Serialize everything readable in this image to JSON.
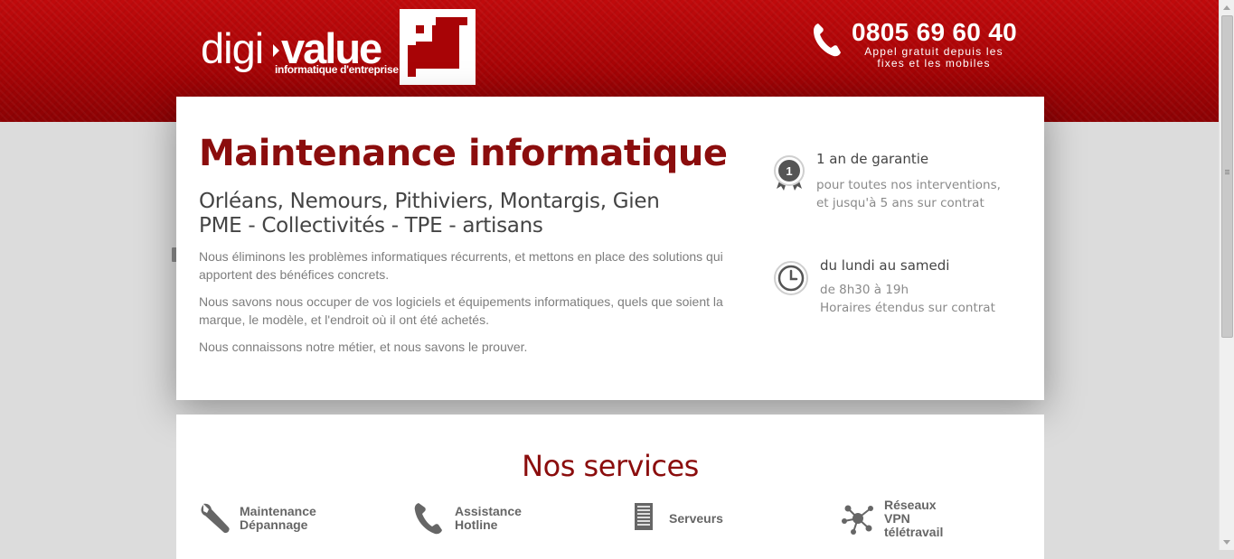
{
  "header": {
    "logo": {
      "word_light": "digi",
      "word_bold": "value",
      "tagline": "informatique d'entreprise"
    },
    "phone": {
      "icon": "phone-icon",
      "number": "0805 69 60 40",
      "subtext": "Appel gratuit depuis les fixes et les mobiles"
    }
  },
  "intro": {
    "title": "Maintenance informatique",
    "subtitle_line1": "Orléans, Nemours, Pithiviers, Montargis, Gien",
    "subtitle_line2": "PME - Collectivités - TPE - artisans",
    "paragraphs": [
      "Nous éliminons les problèmes informatiques récurrents, et mettons en place des solutions qui apportent des bénéfices concrets.",
      "Nous savons nous occuper de vos logiciels et équipements informatiques, quels que soient la marque, le modèle, et l'endroit où il ont été achetés.",
      "Nous connaissons notre métier, et nous savons le prouver."
    ]
  },
  "features": [
    {
      "icon": "award-medal-icon",
      "badge": "1",
      "title": "1 an de garantie",
      "line1": "pour toutes nos interventions,",
      "line2": "et jusqu'à 5 ans sur contrat"
    },
    {
      "icon": "clock-icon",
      "title": "du lundi au samedi",
      "line1": "de 8h30 à 19h",
      "line2": "Horaires étendus sur contrat"
    }
  ],
  "services": {
    "title": "Nos services",
    "items": [
      {
        "icon": "wrench-icon",
        "label": "Maintenance\nDépannage"
      },
      {
        "icon": "phone-handset-icon",
        "label": "Assistance\nHotline"
      },
      {
        "icon": "server-icon",
        "label": "Serveurs"
      },
      {
        "icon": "network-icon",
        "label": "Réseaux\nVPN\ntélétravail"
      }
    ]
  },
  "colors": {
    "brand_red": "#a80406",
    "title_red": "#8b0d0d",
    "text_gray": "#7d7d7d"
  }
}
